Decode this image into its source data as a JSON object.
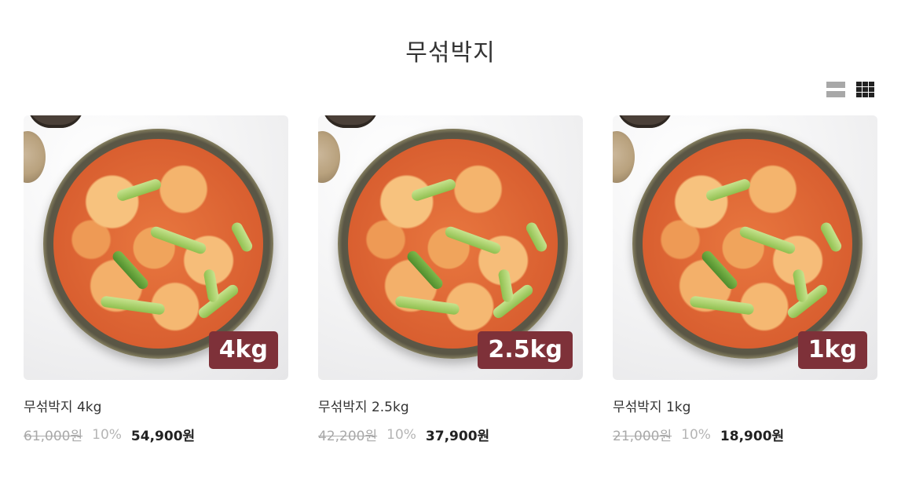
{
  "page": {
    "title": "무섞박지"
  },
  "view_toggle": {
    "list_icon": "list-view-icon",
    "grid_icon": "grid-view-icon",
    "active": "grid"
  },
  "products": [
    {
      "name": "무섞박지 4kg",
      "badge": "4kg",
      "original_price": "61,000원",
      "discount": "10%",
      "sale_price": "54,900원"
    },
    {
      "name": "무섞박지 2.5kg",
      "badge": "2.5kg",
      "original_price": "42,200원",
      "discount": "10%",
      "sale_price": "37,900원"
    },
    {
      "name": "무섞박지 1kg",
      "badge": "1kg",
      "original_price": "21,000원",
      "discount": "10%",
      "sale_price": "18,900원"
    }
  ],
  "colors": {
    "badge_bg": "#7e3139",
    "strike_price": "#a9a9a9",
    "sale_price": "#222222"
  }
}
